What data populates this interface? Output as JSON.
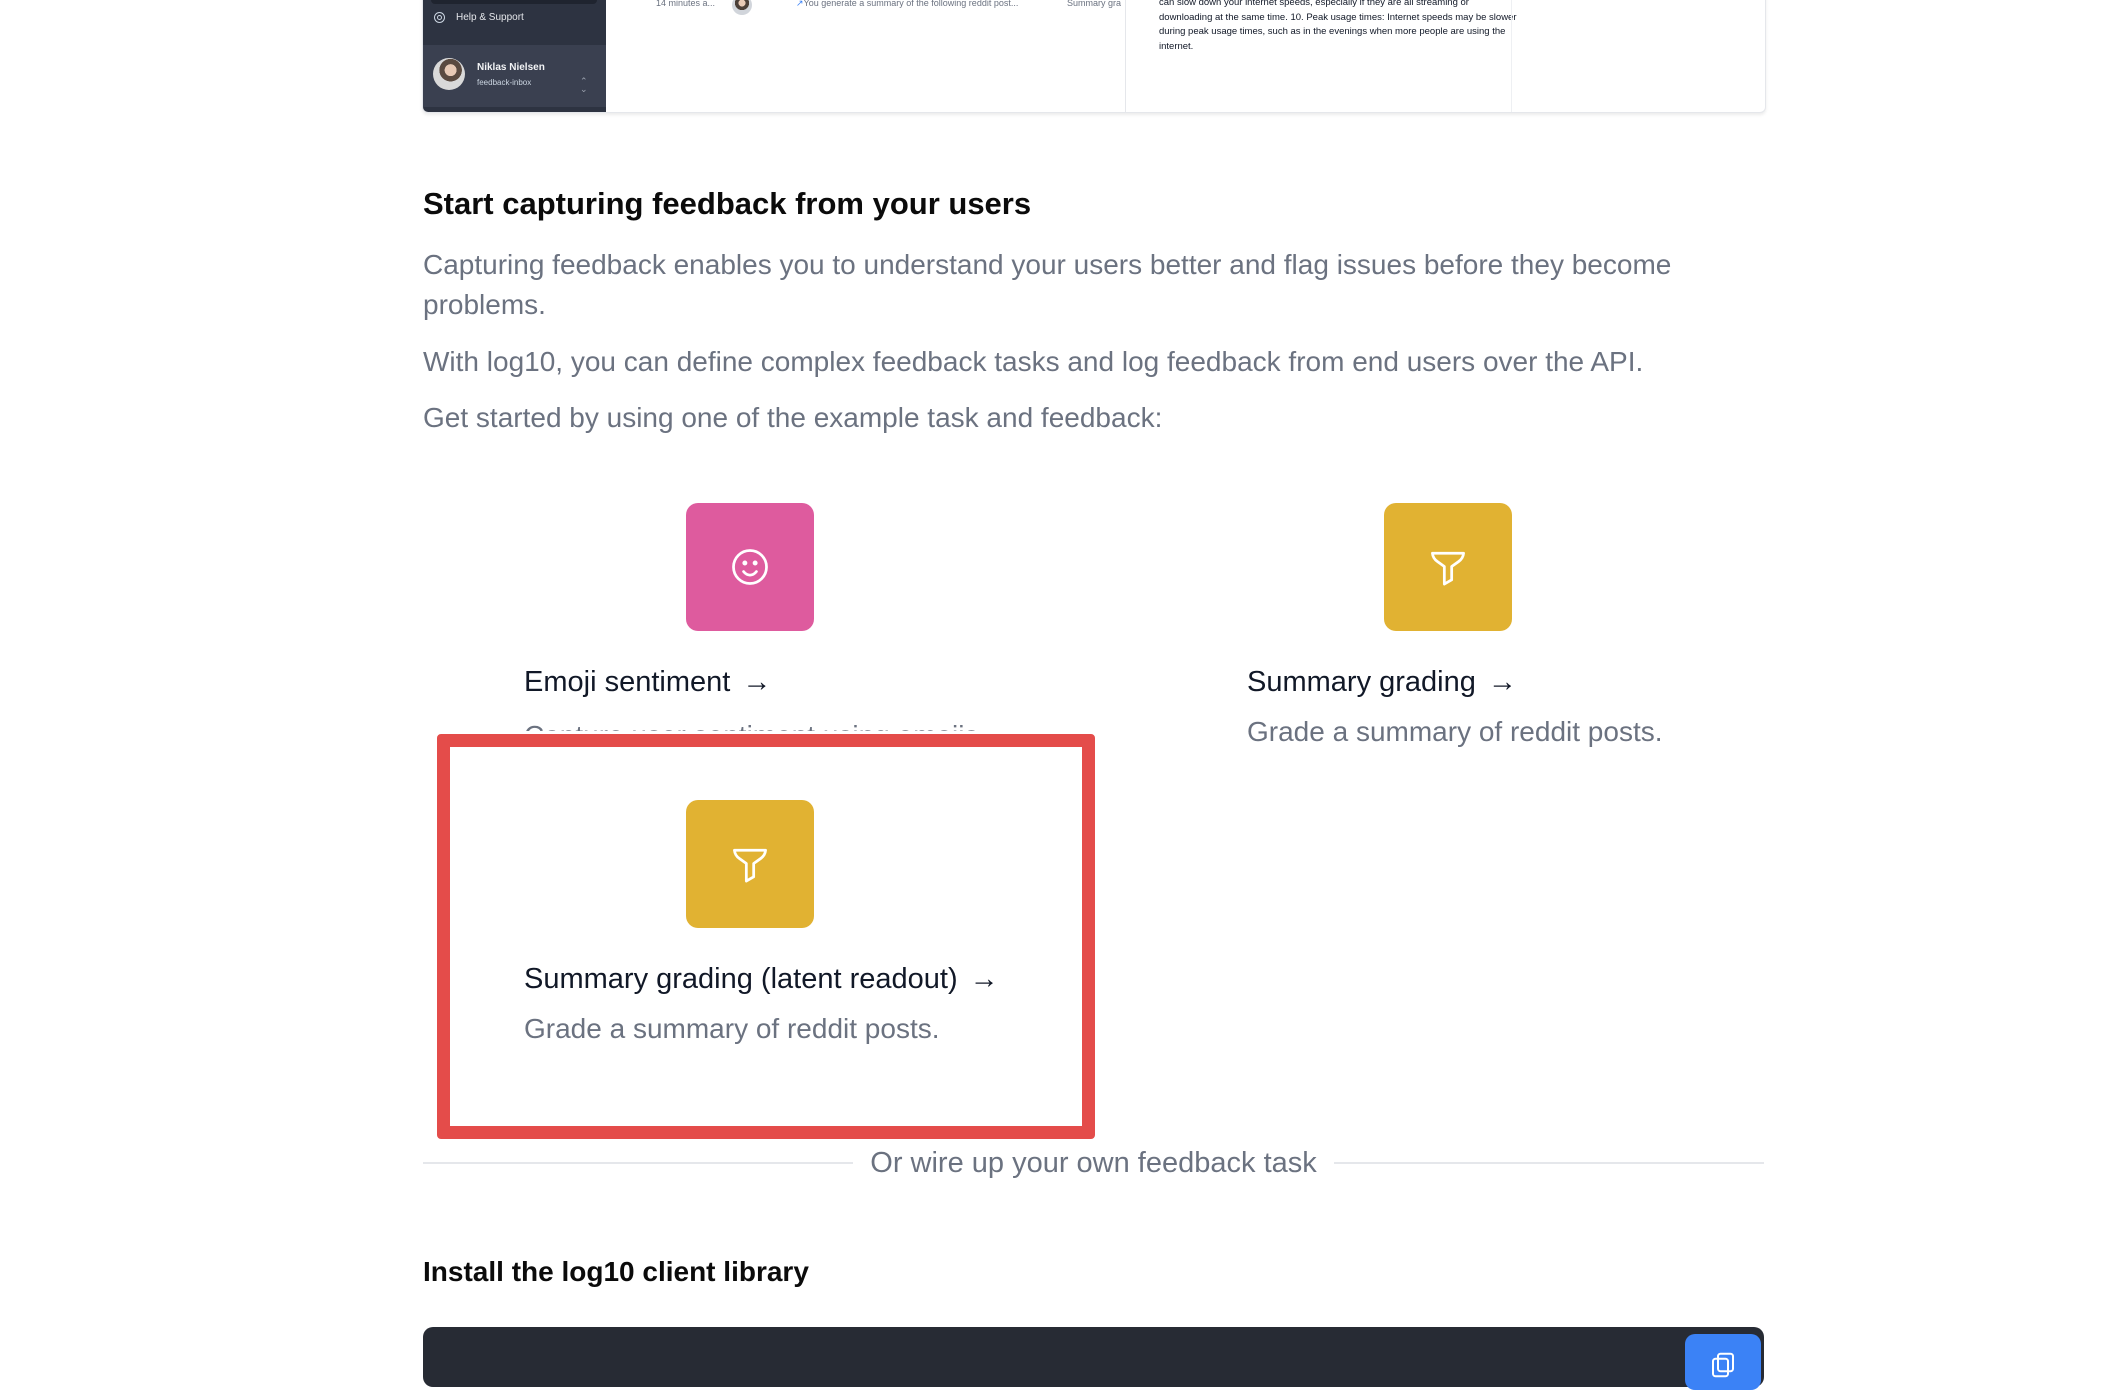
{
  "preview": {
    "sidebar": {
      "help_label": "Help & Support",
      "user_name": "Niklas Nielsen",
      "user_org": "feedback-inbox"
    },
    "completion_row": {
      "time": "14 minutes a...",
      "prompt": "You generate a summary of the following reddit post...",
      "task": "Summary gra"
    },
    "detail_text": "can slow down your internet speeds, especially if they are all streaming or downloading at the same time. 10. Peak usage times: Internet speeds may be slower during peak usage times, such as in the evenings when more people are using the internet."
  },
  "main": {
    "heading": "Start capturing feedback from your users",
    "paragraphs": [
      "Capturing feedback enables you to understand your users better and flag issues before they become problems.",
      "With log10, you can define complex feedback tasks and log feedback from end users over the API.",
      "Get started by using one of the example task and feedback:"
    ],
    "cards": [
      {
        "title": "Emoji sentiment",
        "description": "Capture user sentiment using emojis.",
        "icon": "smiley-icon",
        "color": "#de5b9e"
      },
      {
        "title": "Summary grading",
        "description": "Grade a summary of reddit posts.",
        "icon": "funnel-icon",
        "color": "#e1b232"
      },
      {
        "title": "Summary grading (latent readout)",
        "description": "Grade a summary of reddit posts.",
        "icon": "funnel-icon",
        "color": "#e1b232"
      }
    ],
    "arrow": "→",
    "divider_text": "Or wire up your own feedback task",
    "install_title": "Install the log10 client library"
  },
  "highlight_color": "#e44c4a"
}
